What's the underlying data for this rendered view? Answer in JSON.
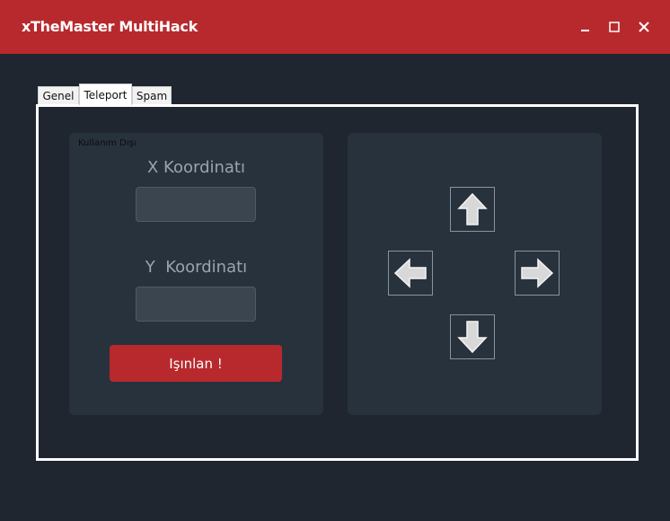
{
  "window": {
    "title": "xTheMaster MultiHack",
    "controls": [
      "minimize-icon",
      "maximize-icon",
      "close-icon"
    ],
    "accent_color": "#b8292d"
  },
  "tabs": [
    {
      "label": "Genel",
      "active": false
    },
    {
      "label": "Teleport",
      "active": true
    },
    {
      "label": "Spam",
      "active": false
    }
  ],
  "teleport": {
    "group_label": "Kullanım Dışı",
    "x_label": "X Koordinatı",
    "x_value": "",
    "y_label": "Y  Koordinatı",
    "y_value": "",
    "button_label": "Işınlan !"
  },
  "movement": {
    "arrows": [
      "arrow-up-icon",
      "arrow-left-icon",
      "arrow-right-icon",
      "arrow-down-icon"
    ]
  }
}
